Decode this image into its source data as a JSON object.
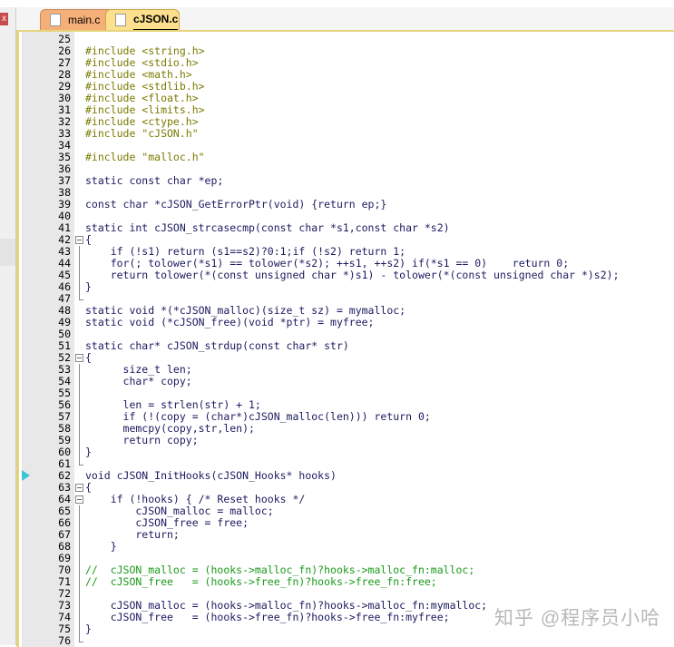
{
  "tabs": [
    {
      "label": "main.c",
      "active": false
    },
    {
      "label": "cJSON.c",
      "active": true
    }
  ],
  "close_label": "x",
  "watermark": "知乎 @程序员小哈",
  "breakpoint_line": 62,
  "lines": [
    {
      "n": 25,
      "t": ""
    },
    {
      "n": 26,
      "t": "#include <string.h>"
    },
    {
      "n": 27,
      "t": "#include <stdio.h>"
    },
    {
      "n": 28,
      "t": "#include <math.h>"
    },
    {
      "n": 29,
      "t": "#include <stdlib.h>"
    },
    {
      "n": 30,
      "t": "#include <float.h>"
    },
    {
      "n": 31,
      "t": "#include <limits.h>"
    },
    {
      "n": 32,
      "t": "#include <ctype.h>"
    },
    {
      "n": 33,
      "t": "#include \"cJSON.h\""
    },
    {
      "n": 34,
      "t": ""
    },
    {
      "n": 35,
      "t": "#include \"malloc.h\""
    },
    {
      "n": 36,
      "t": ""
    },
    {
      "n": 37,
      "t": "static const char *ep;"
    },
    {
      "n": 38,
      "t": ""
    },
    {
      "n": 39,
      "t": "const char *cJSON_GetErrorPtr(void) {return ep;}"
    },
    {
      "n": 40,
      "t": ""
    },
    {
      "n": 41,
      "t": "static int cJSON_strcasecmp(const char *s1,const char *s2)"
    },
    {
      "n": 42,
      "t": "{",
      "f": "box"
    },
    {
      "n": 43,
      "t": "    if (!s1) return (s1==s2)?0:1;if (!s2) return 1;",
      "f": "bar"
    },
    {
      "n": 44,
      "t": "    for(; tolower(*s1) == tolower(*s2); ++s1, ++s2) if(*s1 == 0)    return 0;",
      "f": "bar"
    },
    {
      "n": 45,
      "t": "    return tolower(*(const unsigned char *)s1) - tolower(*(const unsigned char *)s2);",
      "f": "bar"
    },
    {
      "n": 46,
      "t": "}",
      "f": "bar"
    },
    {
      "n": 47,
      "t": "",
      "f": "end"
    },
    {
      "n": 48,
      "t": "static void *(*cJSON_malloc)(size_t sz) = mymalloc;"
    },
    {
      "n": 49,
      "t": "static void (*cJSON_free)(void *ptr) = myfree;"
    },
    {
      "n": 50,
      "t": ""
    },
    {
      "n": 51,
      "t": "static char* cJSON_strdup(const char* str)"
    },
    {
      "n": 52,
      "t": "{",
      "f": "box"
    },
    {
      "n": 53,
      "t": "      size_t len;",
      "f": "bar"
    },
    {
      "n": 54,
      "t": "      char* copy;",
      "f": "bar"
    },
    {
      "n": 55,
      "t": "",
      "f": "bar"
    },
    {
      "n": 56,
      "t": "      len = strlen(str) + 1;",
      "f": "bar"
    },
    {
      "n": 57,
      "t": "      if (!(copy = (char*)cJSON_malloc(len))) return 0;",
      "f": "bar"
    },
    {
      "n": 58,
      "t": "      memcpy(copy,str,len);",
      "f": "bar"
    },
    {
      "n": 59,
      "t": "      return copy;",
      "f": "bar"
    },
    {
      "n": 60,
      "t": "}",
      "f": "bar"
    },
    {
      "n": 61,
      "t": "",
      "f": "end"
    },
    {
      "n": 62,
      "t": "void cJSON_InitHooks(cJSON_Hooks* hooks)"
    },
    {
      "n": 63,
      "t": "{",
      "f": "box"
    },
    {
      "n": 64,
      "t": "    if (!hooks) { /* Reset hooks */",
      "f": "box"
    },
    {
      "n": 65,
      "t": "        cJSON_malloc = malloc;",
      "f": "bar"
    },
    {
      "n": 66,
      "t": "        cJSON_free = free;",
      "f": "bar"
    },
    {
      "n": 67,
      "t": "        return;",
      "f": "bar"
    },
    {
      "n": 68,
      "t": "    }",
      "f": "bar"
    },
    {
      "n": 69,
      "t": "",
      "f": "bar"
    },
    {
      "n": 70,
      "t": "//  cJSON_malloc = (hooks->malloc_fn)?hooks->malloc_fn:malloc;",
      "f": "bar"
    },
    {
      "n": 71,
      "t": "//  cJSON_free   = (hooks->free_fn)?hooks->free_fn:free;",
      "f": "bar"
    },
    {
      "n": 72,
      "t": "",
      "f": "bar"
    },
    {
      "n": 73,
      "t": "    cJSON_malloc = (hooks->malloc_fn)?hooks->malloc_fn:mymalloc;",
      "f": "bar"
    },
    {
      "n": 74,
      "t": "    cJSON_free   = (hooks->free_fn)?hooks->free_fn:myfree;",
      "f": "bar"
    },
    {
      "n": 75,
      "t": "}",
      "f": "bar"
    },
    {
      "n": 76,
      "t": "",
      "f": "end"
    }
  ]
}
